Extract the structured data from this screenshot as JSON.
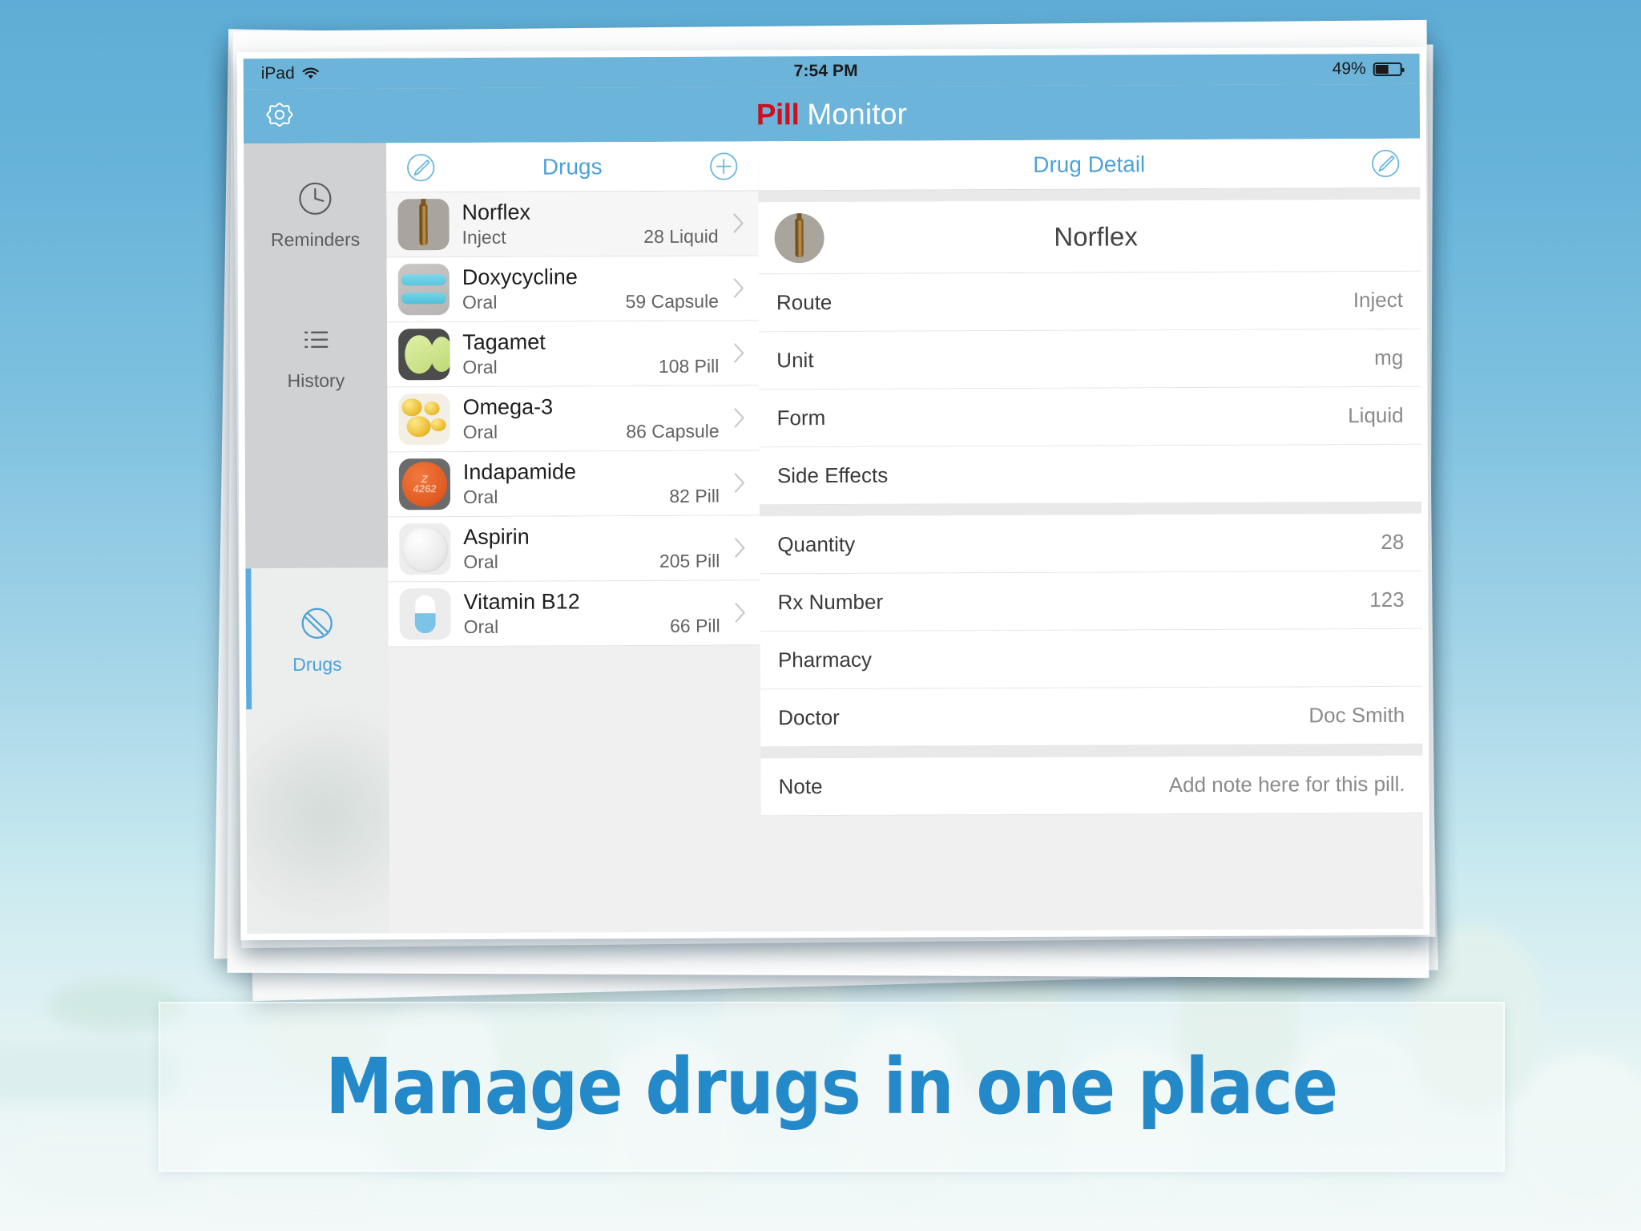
{
  "status_bar": {
    "device": "iPad",
    "wifi_icon": "wifi-icon",
    "time": "7:54 PM",
    "battery_percent": "49%",
    "battery_icon": "battery-icon"
  },
  "navbar": {
    "settings_icon": "gear-icon",
    "brand_primary": "Pill",
    "brand_secondary": "Monitor"
  },
  "sidebar": {
    "items": [
      {
        "label": "Reminders",
        "icon": "clock-icon",
        "active": false
      },
      {
        "label": "History",
        "icon": "list-icon",
        "active": false
      },
      {
        "label": "Drugs",
        "icon": "tablet-pill-icon",
        "active": true
      }
    ]
  },
  "master": {
    "edit_icon": "edit-pencil-circle-icon",
    "title": "Drugs",
    "add_icon": "plus-circle-icon",
    "rows": [
      {
        "name": "Norflex",
        "route": "Inject",
        "count": "28 Liquid",
        "thumb": "ampoule-thumb",
        "selected": true
      },
      {
        "name": "Doxycycline",
        "route": "Oral",
        "count": "59 Capsule",
        "thumb": "blue-capsule-thumb",
        "selected": false
      },
      {
        "name": "Tagamet",
        "route": "Oral",
        "count": "108 Pill",
        "thumb": "green-oval-thumb",
        "selected": false
      },
      {
        "name": "Omega-3",
        "route": "Oral",
        "count": "86 Capsule",
        "thumb": "fish-oil-thumb",
        "selected": false
      },
      {
        "name": "Indapamide",
        "route": "Oral",
        "count": "82 Pill",
        "thumb": "orange-tablet-thumb",
        "selected": false
      },
      {
        "name": "Aspirin",
        "route": "Oral",
        "count": "205 Pill",
        "thumb": "white-tablet-thumb",
        "selected": false
      },
      {
        "name": "Vitamin B12",
        "route": "Oral",
        "count": "66 Pill",
        "thumb": "blue-capsule2-thumb",
        "selected": false
      }
    ]
  },
  "detail": {
    "title": "Drug Detail",
    "edit_icon": "edit-pencil-circle-icon",
    "drug_name": "Norflex",
    "thumb": "ampoule-thumb",
    "group1": [
      {
        "label": "Route",
        "value": "Inject"
      },
      {
        "label": "Unit",
        "value": "mg"
      },
      {
        "label": "Form",
        "value": "Liquid"
      },
      {
        "label": "Side Effects",
        "value": ""
      }
    ],
    "group2": [
      {
        "label": "Quantity",
        "value": "28"
      },
      {
        "label": "Rx Number",
        "value": "123"
      },
      {
        "label": "Pharmacy",
        "value": ""
      },
      {
        "label": "Doctor",
        "value": "Doc Smith"
      }
    ],
    "group3": [
      {
        "label": "Note",
        "value": "Add note here for this pill."
      }
    ]
  },
  "caption": {
    "text": "Manage drugs in one place"
  },
  "colors": {
    "navbar_blue": "#6cb4d9",
    "accent_blue": "#4da2d6",
    "brand_red": "#cc1020",
    "caption_blue": "#2389c9",
    "sidebar_gray": "#d0d1d3"
  }
}
